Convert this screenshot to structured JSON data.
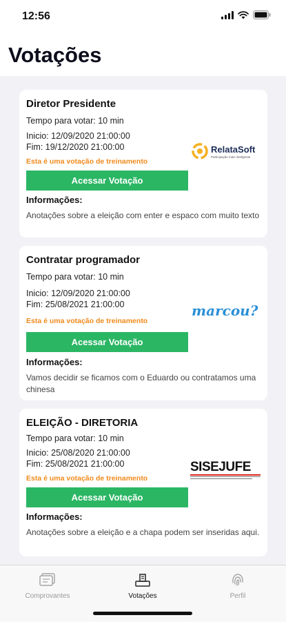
{
  "status_bar": {
    "time": "12:56"
  },
  "page": {
    "title": "Votações"
  },
  "cards": [
    {
      "title": "Diretor Presidente",
      "time_to_vote": "Tempo para votar: 10 min",
      "start": "Inicio: 12/09/2020 21:00:00",
      "end": "Fim: 19/12/2020 21:00:00",
      "training_notice": "Esta é uma votação de treinamento",
      "button_label": "Acessar Votação",
      "info_label": "Informações:",
      "info_text": "Anotações sobre a eleição com enter e espaco com muito texto",
      "logo": {
        "name": "RelataSoft",
        "tagline": "Participação mais inteligente",
        "color": "#1b2d58",
        "accent": "#f4b021"
      }
    },
    {
      "title": "Contratar programador",
      "time_to_vote": "Tempo para votar: 10 min",
      "start": "Inicio: 12/09/2020 21:00:00",
      "end": "Fim: 25/08/2021 21:00:00",
      "training_notice": "Esta é uma votação de treinamento",
      "button_label": "Acessar Votação",
      "info_label": "Informações:",
      "info_text": "Vamos decidir se ficamos com o Eduardo ou contratamos uma chinesa",
      "logo": {
        "name": "marcou?",
        "color": "#2a8fd6"
      }
    },
    {
      "title": "ELEIÇÃO - DIRETORIA",
      "time_to_vote": "Tempo para votar: 10 min",
      "start": "Inicio: 25/08/2020 21:00:00",
      "end": "Fim: 25/08/2021 21:00:00",
      "training_notice": "Esta é uma votação de treinamento",
      "button_label": "Acessar Votação",
      "info_label": "Informações:",
      "info_text": "Anotações sobre a eleição e a chapa podem ser inseridas aqui.",
      "logo": {
        "name": "SISEJUFE",
        "color": "#111111",
        "accent": "#d9261c"
      }
    }
  ],
  "tab_bar": {
    "tabs": [
      {
        "label": "Comprovantes",
        "icon": "receipt-icon",
        "active": false
      },
      {
        "label": "Votações",
        "icon": "ballot-icon",
        "active": true
      },
      {
        "label": "Perfil",
        "icon": "fingerprint-icon",
        "active": false
      }
    ]
  },
  "colors": {
    "button": "#2bb664",
    "training": "#f08a1c",
    "background": "#f2f2f6"
  }
}
